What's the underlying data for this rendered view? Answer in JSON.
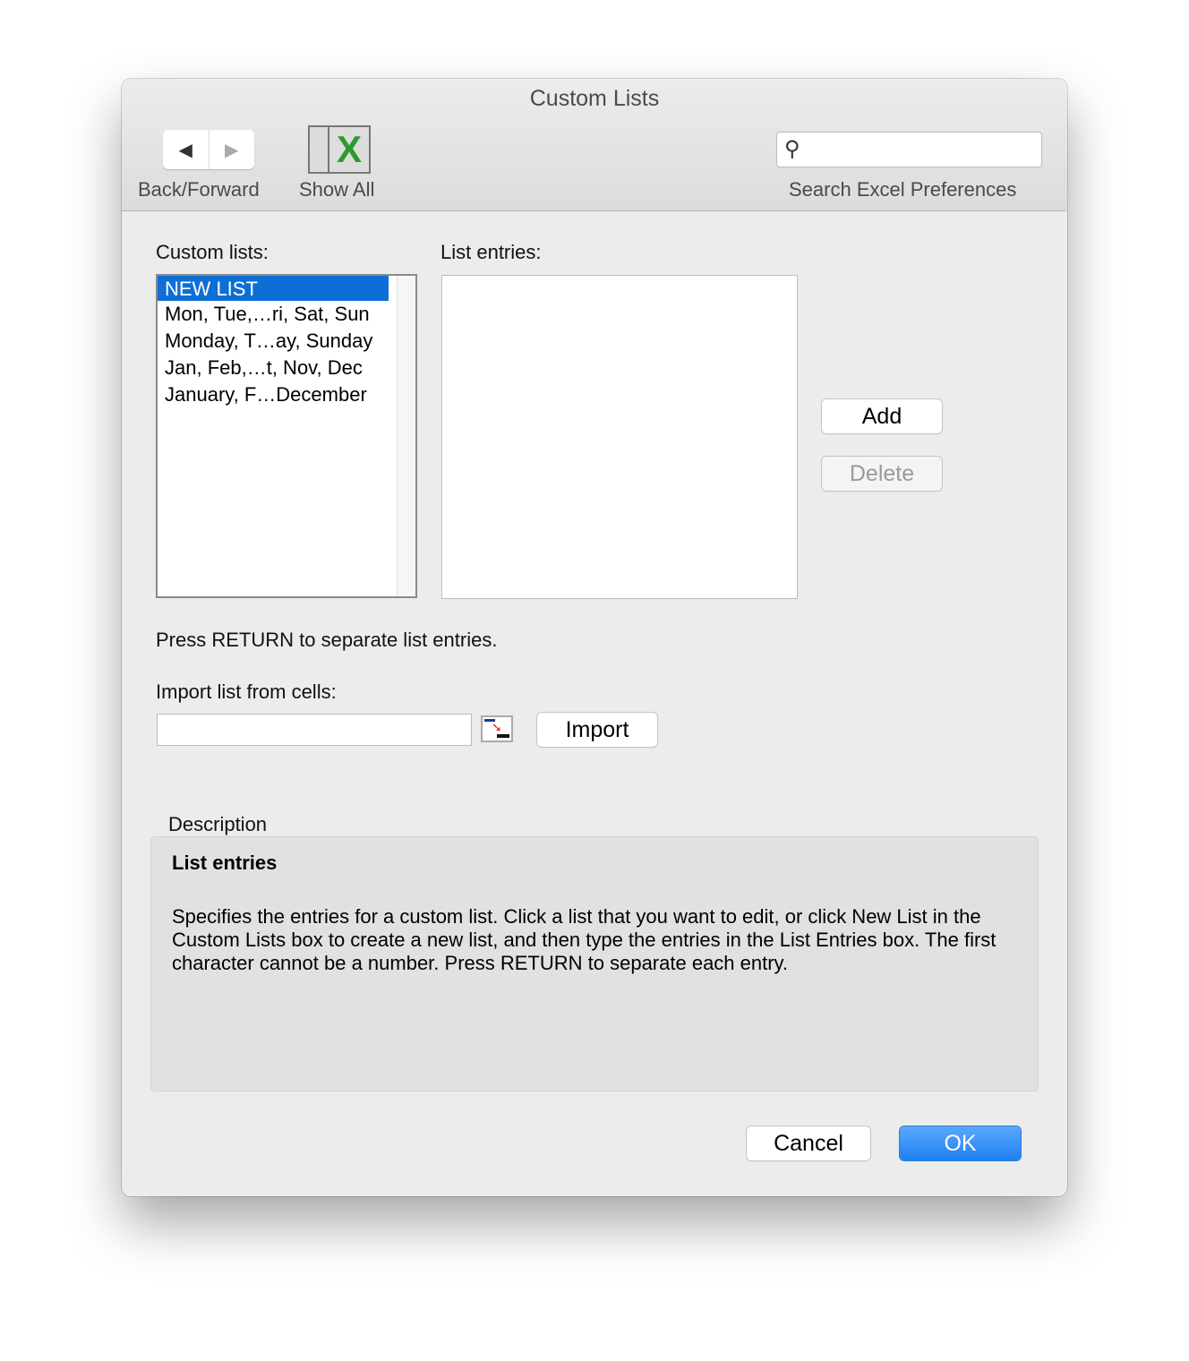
{
  "window": {
    "title": "Custom Lists"
  },
  "toolbar": {
    "back_forward_label": "Back/Forward",
    "show_all_label": "Show All",
    "search_placeholder": "",
    "search_label": "Search Excel Preferences"
  },
  "custom_lists": {
    "label": "Custom lists:",
    "items": [
      "NEW LIST",
      "Mon, Tue,…ri, Sat, Sun",
      "Monday, T…ay, Sunday",
      "Jan, Feb,…t, Nov, Dec",
      "January, F…December"
    ],
    "selected": "NEW LIST"
  },
  "list_entries": {
    "label": "List entries:",
    "value": ""
  },
  "buttons": {
    "add": "Add",
    "delete": "Delete",
    "import": "Import",
    "cancel": "Cancel",
    "ok": "OK"
  },
  "hint": "Press RETURN to separate list entries.",
  "import": {
    "label": "Import list from cells:",
    "value": ""
  },
  "description": {
    "heading": "Description",
    "title": "List entries",
    "body": "Specifies the entries for a custom list. Click a list that you want to edit, or click New List in the Custom Lists box to create a new list, and then type the entries in the List Entries box. The first character cannot be a number. Press RETURN to separate each entry."
  },
  "colors": {
    "accent": "#0d6fd6",
    "excel_green": "#2e9a2e"
  }
}
